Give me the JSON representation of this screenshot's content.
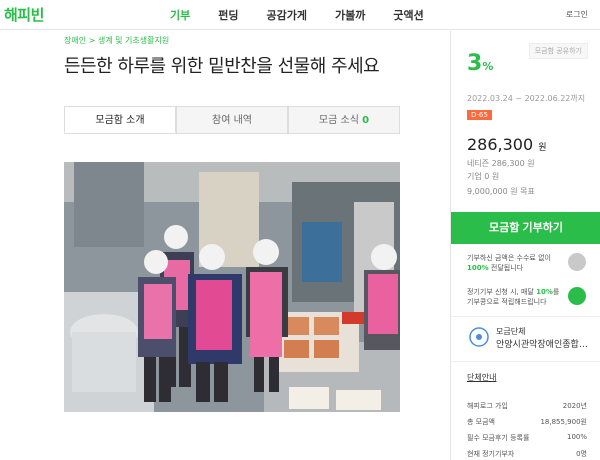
{
  "header": {
    "logo": "해피빈",
    "nav": [
      "기부",
      "펀딩",
      "공감가게",
      "가볼까",
      "굿액션"
    ],
    "login": "로그인"
  },
  "fundraiser": {
    "breadcrumb": "장애인 > 생계 및 기초생활지원",
    "title": "든든한 하루를 위한 밑반찬을 선물해 주세요",
    "tabs": [
      {
        "label": "모금함 소개",
        "count": ""
      },
      {
        "label": "참여 내역",
        "count": ""
      },
      {
        "label": "모금 소식",
        "count": "0"
      }
    ],
    "photo_alt": "급식실에서 앞치마를 두른 봉사자들이 반찬을 담는 모습"
  },
  "sidebar": {
    "percent": "3",
    "percent_unit": "%",
    "progress": 0.03,
    "share_label": "모금함 공유하기",
    "period": "2022.03.24 ~ 2022.06.22까지",
    "dday": "D-65",
    "amount": "286,300",
    "amount_unit": "원",
    "netizen": "네티즌 286,300 원",
    "corp": "기업 0 원",
    "goal": "9,000,000 원 목표",
    "donate_label": "모금함 기부하기",
    "info1_prefix": "기부하신 금액은 수수료 없이",
    "info1_bold": "100%",
    "info1_suffix": "전달됩니다",
    "info2_prefix": "정기기부 신청 시, 매달",
    "info2_bold": "10%",
    "info2_suffix": "를 기부콩으로 적립해드립니다",
    "org_label": "모금단체",
    "org_name": "안양시관악장애인종합복지관",
    "org_link": "단체안내",
    "stats": [
      {
        "label": "해피로그 가입",
        "value": "2020년"
      },
      {
        "label": "총 모금액",
        "value": "18,855,900원"
      },
      {
        "label": "필수 모금후기 등록률",
        "value": "100%"
      },
      {
        "label": "현재 정기기부자",
        "value": "0명"
      }
    ]
  },
  "colors": {
    "brand": "#2bbd49",
    "dday": "#ff6a3d"
  }
}
